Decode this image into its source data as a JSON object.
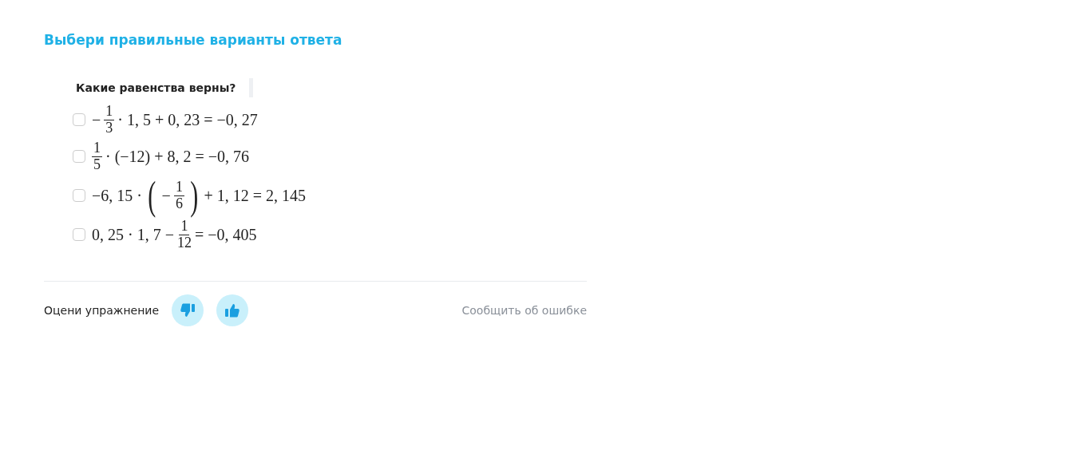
{
  "heading": "Выбери правильные варианты ответа",
  "question": "Какие равенства верны?",
  "options": [
    {
      "checked": false,
      "parts": [
        {
          "kind": "text",
          "text": "−"
        },
        {
          "kind": "frac",
          "num": "1",
          "den": "3"
        },
        {
          "kind": "text",
          "text": "· 1, 5 + 0, 23 = −0, 27"
        }
      ]
    },
    {
      "checked": false,
      "parts": [
        {
          "kind": "frac",
          "num": "1",
          "den": "5"
        },
        {
          "kind": "text",
          "text": "· (−12) + 8, 2 = −0, 76"
        }
      ]
    },
    {
      "checked": false,
      "parts": [
        {
          "kind": "text",
          "text": "−6, 15 ·"
        },
        {
          "kind": "paren",
          "text": "("
        },
        {
          "kind": "text",
          "text": "−"
        },
        {
          "kind": "frac",
          "num": "1",
          "den": "6"
        },
        {
          "kind": "paren",
          "text": ")"
        },
        {
          "kind": "text",
          "text": "+ 1, 12 = 2, 145"
        }
      ]
    },
    {
      "checked": false,
      "parts": [
        {
          "kind": "text",
          "text": "0, 25 · 1, 7 −"
        },
        {
          "kind": "frac",
          "num": "1",
          "den": "12"
        },
        {
          "kind": "text",
          "text": "= −0, 405"
        }
      ]
    }
  ],
  "footer": {
    "rate_label": "Оцени упражнение",
    "report_link": "Сообщить об ошибке"
  }
}
